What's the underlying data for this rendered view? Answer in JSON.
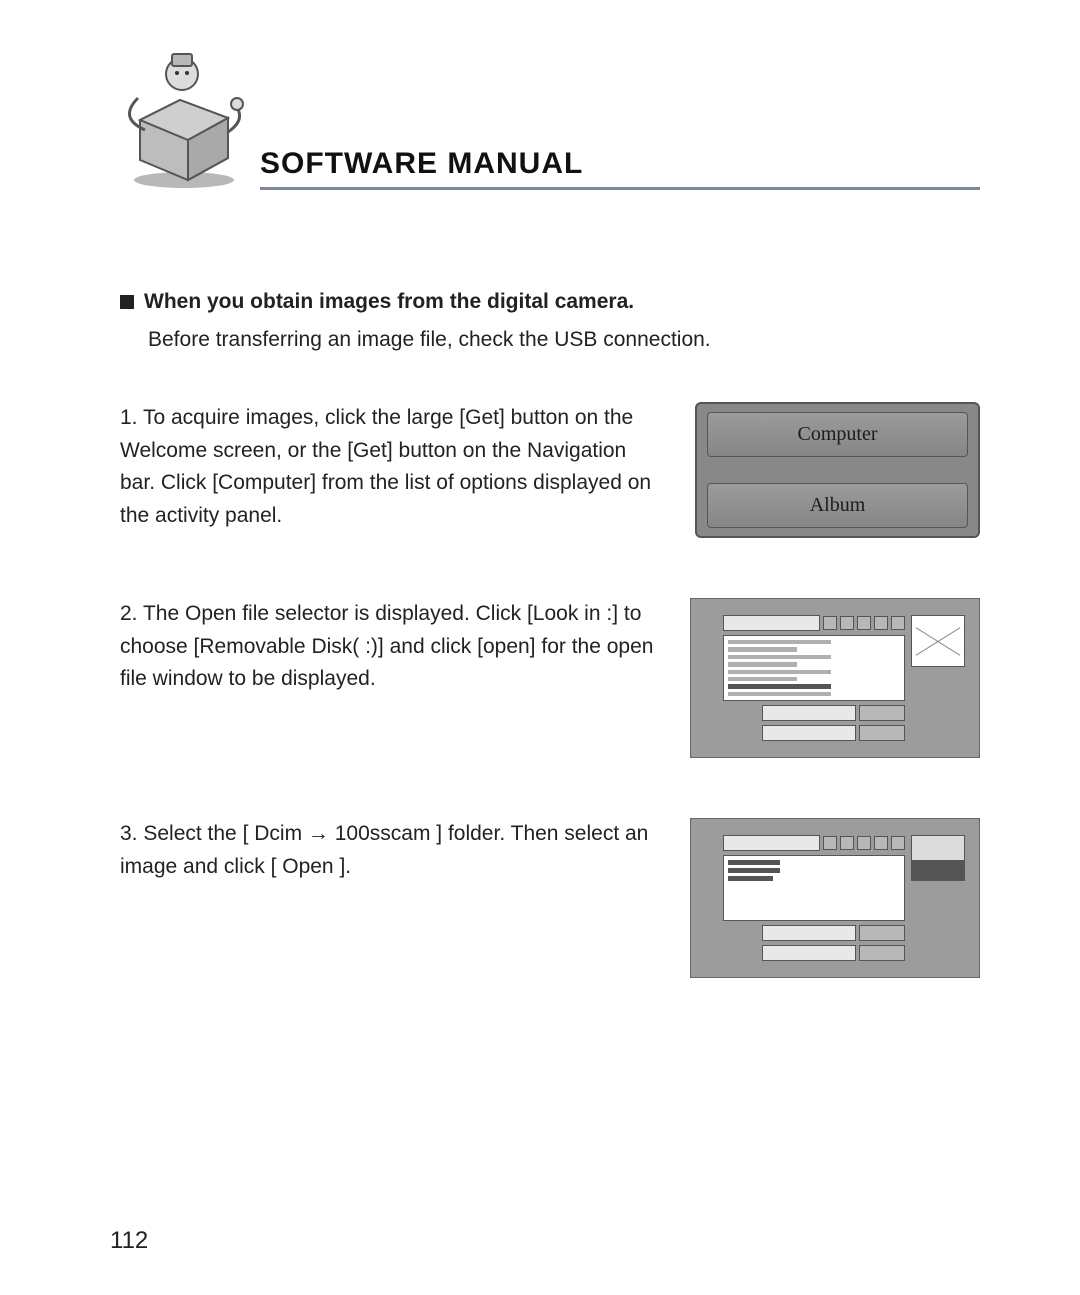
{
  "header": {
    "title": "SOFTWARE MANUAL"
  },
  "section": {
    "heading": "When you obtain images from the digital camera.",
    "intro": "Before transferring an image file, check the USB connection."
  },
  "steps": {
    "s1": "1. To acquire images, click the large [Get] button on the Welcome screen, or the [Get] button on the Navigation bar. Click [Computer] from the list of options displayed on the activity panel.",
    "s2": "2. The Open file selector is displayed. Click [Look in :] to choose [Removable Disk( :)] and click [open] for the open file window to be displayed.",
    "s3": "3. Select the [ Dcim → 100sscam ] folder. Then select an image and click [ Open ]."
  },
  "illustration_buttons": {
    "computer": "Computer",
    "album": "Album"
  },
  "page_number": "112"
}
